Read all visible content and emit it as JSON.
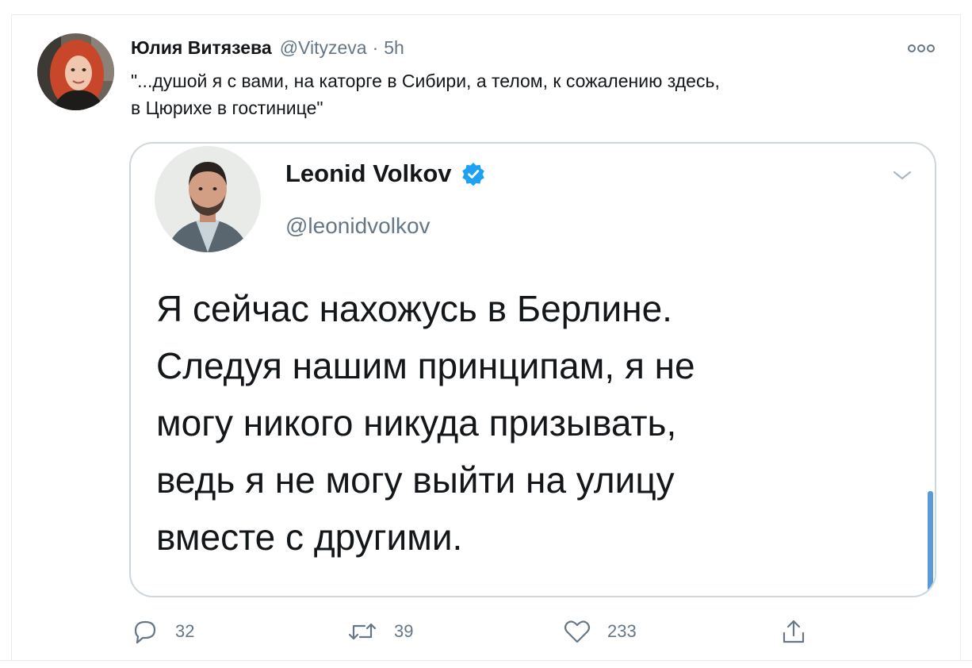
{
  "tweet": {
    "author_name": "Юлия Витязева",
    "handle": "@Vityzeva",
    "separator": "·",
    "time": "5h",
    "text": "\"...душой я с вами, на каторге в Сибири, а телом, к сожалению здесь,\nв Цюрихе в гостинице\"",
    "avatar_icon": "profile-photo-woman",
    "more_icon": "more-options-icon"
  },
  "embedded_image": {
    "author_name": "Leonid Volkov",
    "handle": "@leonidvolkov",
    "verified_icon": "verified-badge-icon",
    "chevron_icon": "chevron-down-icon",
    "text": "Я сейчас нахожусь в Берлине.\nСледуя нашим принципам, я не\nмогу никого никуда призывать,\nведь я не могу выйти на улицу\nвместе с другими.",
    "accent_color": "#1da1f2"
  },
  "actions": {
    "replies": "32",
    "retweets": "39",
    "likes": "233"
  },
  "colors": {
    "text": "#14171a",
    "secondary": "#657786",
    "border": "#e6ecf0"
  }
}
